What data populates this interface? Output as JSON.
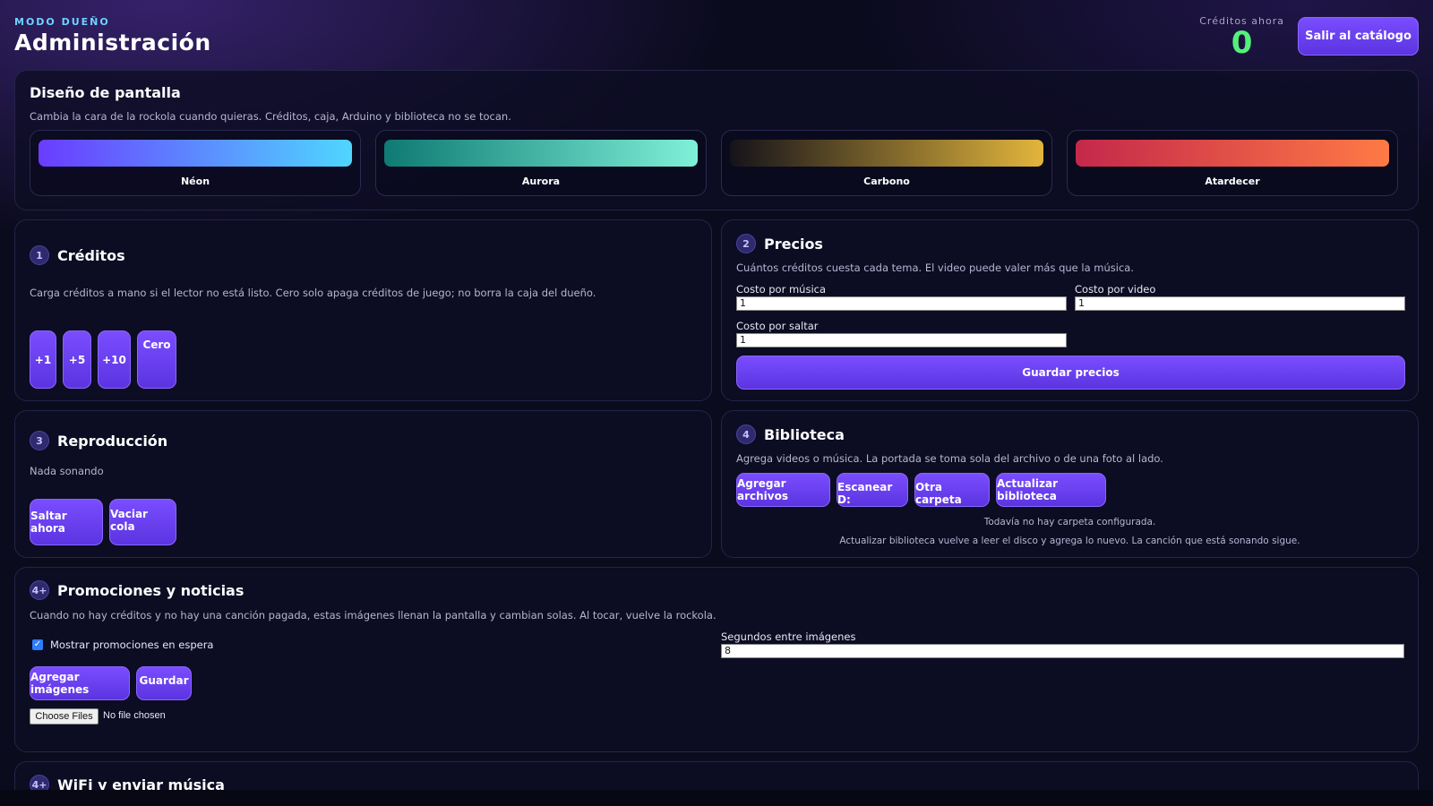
{
  "header": {
    "eyebrow": "MODO DUEÑO",
    "title": "Administración",
    "credits_label": "Créditos ahora",
    "credits_value": "0",
    "exit_label": "Salir al catálogo"
  },
  "design": {
    "title": "Diseño de pantalla",
    "desc": "Cambia la cara de la rockola cuando quieras. Créditos, caja, Arduino y biblioteca no se tocan.",
    "themes": [
      {
        "name": "Néon",
        "from": "#6a3cff",
        "to": "#4fd6ff"
      },
      {
        "name": "Aurora",
        "from": "#0e7a73",
        "to": "#7ff0d8"
      },
      {
        "name": "Carbono",
        "from": "#15131a",
        "to": "#e2b53c"
      },
      {
        "name": "Atardecer",
        "from": "#c4284a",
        "to": "#ff7a45"
      }
    ]
  },
  "credits": {
    "num": "1",
    "title": "Créditos",
    "desc": "Carga créditos a mano si el lector no está listo. Cero solo apaga créditos de juego; no borra la caja del dueño.",
    "buttons": [
      "+1",
      "+5",
      "+10",
      "Cero"
    ]
  },
  "prices": {
    "num": "2",
    "title": "Precios",
    "desc": "Cuántos créditos cuesta cada tema. El video puede valer más que la música.",
    "music_label": "Costo por música",
    "music_value": "1",
    "video_label": "Costo por video",
    "video_value": "1",
    "skip_label": "Costo por saltar",
    "skip_value": "1",
    "save_label": "Guardar precios"
  },
  "playback": {
    "num": "3",
    "title": "Reproducción",
    "status": "Nada sonando",
    "skip_label": "Saltar ahora",
    "clear_label": "Vaciar cola"
  },
  "library": {
    "num": "4",
    "title": "Biblioteca",
    "desc": "Agrega videos o música. La portada se toma sola del archivo o de una foto al lado.",
    "add_label": "Agregar archivos",
    "scan_label": "Escanear D:",
    "folder_label": "Otra carpeta",
    "refresh_label": "Actualizar biblioteca",
    "note1": "Todavía no hay carpeta configurada.",
    "note2": "Actualizar biblioteca vuelve a leer el disco y agrega lo nuevo. La canción que está sonando sigue."
  },
  "promos": {
    "num": "4+",
    "title": "Promociones y noticias",
    "desc": "Cuando no hay créditos y no hay una canción pagada, estas imágenes llenan la pantalla y cambian solas. Al tocar, vuelve la rockola.",
    "checkbox_label": "Mostrar promociones en espera",
    "add_label": "Agregar imágenes",
    "save_label": "Guardar",
    "seconds_label": "Segundos entre imágenes",
    "seconds_value": "8",
    "file_button": "Choose Files",
    "file_text": "No file chosen"
  },
  "wifi": {
    "num": "4+",
    "title": "WiFi y enviar música"
  }
}
